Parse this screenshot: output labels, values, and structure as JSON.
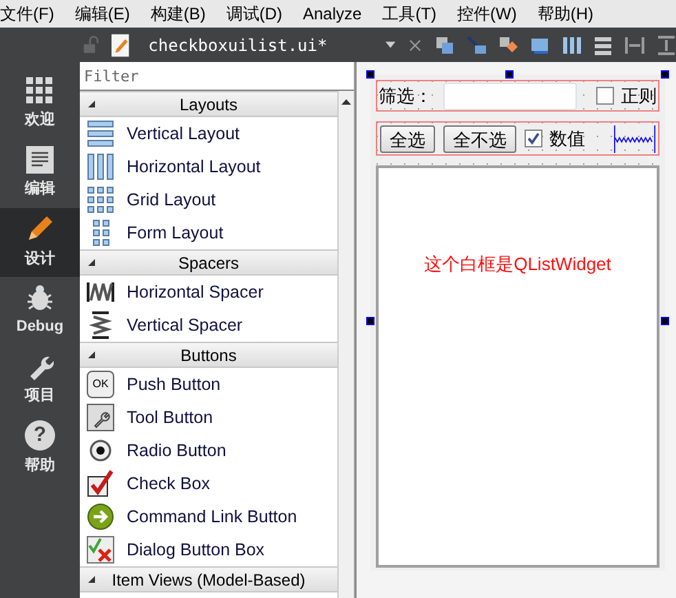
{
  "menu": [
    "文件(F)",
    "编辑(E)",
    "构建(B)",
    "调试(D)",
    "Analyze",
    "工具(T)",
    "控件(W)",
    "帮助(H)"
  ],
  "editor_tab": {
    "file_name": "checkboxuilist.ui*"
  },
  "sidebar": {
    "items": [
      {
        "label": "欢迎",
        "selected": false
      },
      {
        "label": "编辑",
        "selected": false
      },
      {
        "label": "设计",
        "selected": true
      },
      {
        "label": "Debug",
        "selected": false
      },
      {
        "label": "项目",
        "selected": false
      },
      {
        "label": "帮助",
        "selected": false,
        "icon_text": "?"
      }
    ]
  },
  "widget_box": {
    "filter": {
      "placeholder": "Filter"
    },
    "groups": [
      {
        "title": "Layouts",
        "items": [
          {
            "label": "Vertical Layout"
          },
          {
            "label": "Horizontal Layout"
          },
          {
            "label": "Grid Layout"
          },
          {
            "label": "Form Layout"
          }
        ]
      },
      {
        "title": "Spacers",
        "items": [
          {
            "label": "Horizontal Spacer"
          },
          {
            "label": "Vertical Spacer"
          }
        ]
      },
      {
        "title": "Buttons",
        "items": [
          {
            "label": "Push Button",
            "icon_text": "OK"
          },
          {
            "label": "Tool Button"
          },
          {
            "label": "Radio Button"
          },
          {
            "label": "Check Box"
          },
          {
            "label": "Command Link Button"
          },
          {
            "label": "Dialog Button Box"
          }
        ]
      },
      {
        "title": "Item Views (Model-Based)"
      }
    ]
  },
  "form": {
    "filter_label": "筛选：",
    "regex_checkbox": {
      "label": "正则",
      "checked": false
    },
    "buttons": [
      "全选",
      "全不选"
    ],
    "value_checkbox": {
      "label": "数值",
      "checked": true
    },
    "list_note": "这个白框是QListWidget"
  }
}
